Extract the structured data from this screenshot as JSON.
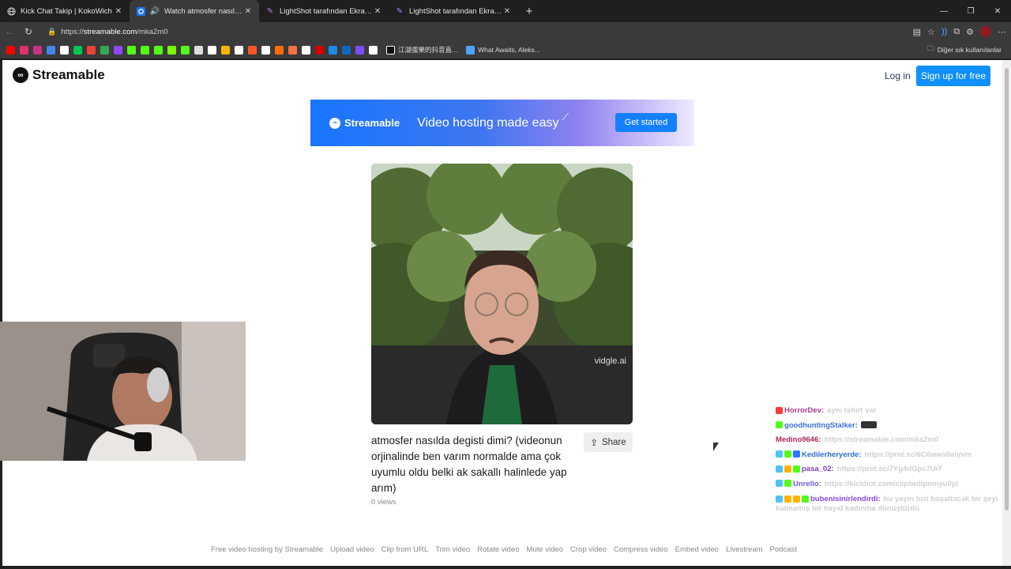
{
  "tabs": [
    {
      "title": "Kick Chat Takip | KokoWich",
      "icon": "globe-icon",
      "active": false
    },
    {
      "title": "Watch atmosfer nasılda degisti dimi? (videonun orjinalinde ben varım normalde ama çok uyumlu oldu belki ak sakallı halinlede yap arım)",
      "icon": "streamable-icon",
      "active": true
    },
    {
      "title": "LightShot tarafından Ekran Görüntüsü",
      "icon": "feather-icon",
      "active": false
    },
    {
      "title": "LightShot tarafından Ekran Görüntüsü",
      "icon": "feather-icon",
      "active": false
    }
  ],
  "address": {
    "scheme": "https://",
    "host": "streamable.com",
    "path": "/mka2m0"
  },
  "bookmarks": {
    "colors": [
      "#ff0000",
      "#e1306c",
      "#c13584",
      "#4285f4",
      "#ffffff",
      "#00c853",
      "#ea4335",
      "#34a853",
      "#9146ff",
      "#53fc18",
      "#53fc18",
      "#53fc18",
      "#7cfc00",
      "#53fc18",
      "#dddddd",
      "#ffffff",
      "#ffb300",
      "#ffffff",
      "#ff5722",
      "#ffffff",
      "#ff6d00",
      "#ff7043",
      "#ffffff",
      "#d50000",
      "#1e88e5",
      "#1565c0",
      "#7c4dff",
      "#ffffff"
    ],
    "named": [
      "江湖蛋樂的抖音直...",
      "What Awaits, Aleks..."
    ],
    "folder": "Diğer sık kullanılanlar"
  },
  "site": {
    "logo": "Streamable",
    "login": "Log in",
    "signup": "Sign up for free"
  },
  "banner": {
    "logo": "Streamable",
    "tagline": "Video hosting made easy",
    "cta": "Get started"
  },
  "video": {
    "watermark": "vidgle.ai",
    "title": "atmosfer nasılda degisti dimi? (videonun orjinalinde ben varım normalde ama çok uyumlu oldu belki ak sakallı halinlede yap arım)",
    "share": "Share",
    "views": "0 views"
  },
  "footer": [
    "Free video hosting by Streamable",
    "Upload video",
    "Clip from URL",
    "Trim video",
    "Rotate video",
    "Mute video",
    "Crop video",
    "Compress video",
    "Embed video",
    "Livestream",
    "Podcast"
  ],
  "chat": [
    {
      "user": "HorrorDev:",
      "color": "#b03a8a",
      "msg": "aynı tshirt var"
    },
    {
      "user": "goodhuntingStalker:",
      "color": "#3a6fd8",
      "msg": ""
    },
    {
      "user": "Medino9646:",
      "color": "#b0245a",
      "msg": "https://streamable.com/mka2m0"
    },
    {
      "user": "Kedilerheryerde:",
      "color": "#2f6fd0",
      "msg": "https://prnt.sc/6C6wws0alyvm"
    },
    {
      "user": "pasa_02:",
      "color": "#7a3fc2",
      "msg": "https://prnt.sc/7Yg4dGpc7UiT"
    },
    {
      "user": "Unrello:",
      "color": "#6d5fd6",
      "msg": "https://kickbot.com/clip/wdipmnyu0pi"
    },
    {
      "user": "bubenisinirlendirdi:",
      "color": "#8a45d8",
      "msg": "bu yayın bizi boşaltacak bir şeyi kalmamış bir hayat kadınına dönüştürdü"
    }
  ]
}
